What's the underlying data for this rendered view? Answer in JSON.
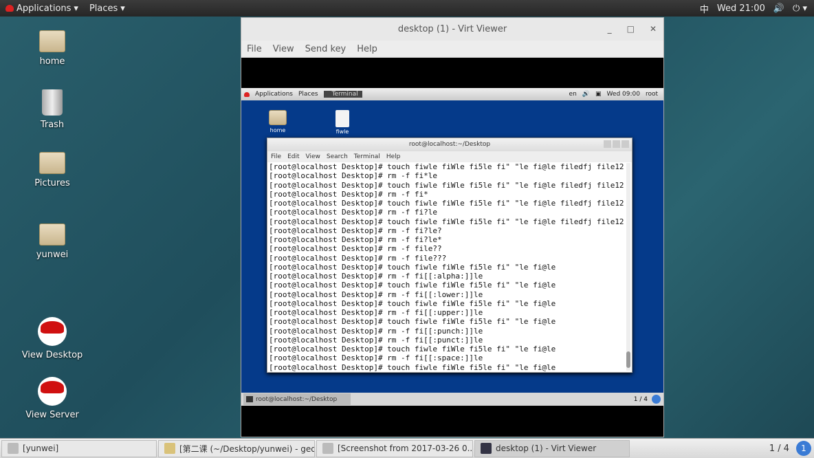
{
  "topbar": {
    "applications": "Applications",
    "places": "Places",
    "input_method": "中",
    "clock": "Wed 21:00"
  },
  "desktop_icons": [
    {
      "label": "home"
    },
    {
      "label": "Trash"
    },
    {
      "label": "Pictures"
    },
    {
      "label": "yunwei"
    },
    {
      "label": "View Desktop"
    },
    {
      "label": "View Server"
    }
  ],
  "viewer": {
    "title": "desktop (1) - Virt Viewer",
    "menu": [
      "File",
      "View",
      "Send key",
      "Help"
    ]
  },
  "guest": {
    "topbar": {
      "applications": "Applications",
      "places": "Places",
      "task": "Terminal",
      "lang": "en",
      "clock": "Wed 09:00",
      "user": "root"
    },
    "icons": [
      {
        "label": "home"
      },
      {
        "label": "fiwle"
      }
    ],
    "terminal": {
      "title": "root@localhost:~/Desktop",
      "menu": [
        "File",
        "Edit",
        "View",
        "Search",
        "Terminal",
        "Help"
      ],
      "lines": [
        "[root@localhost Desktop]# touch fiwle fiWle fi5le fi\" \"le fi@le filedfj file12",
        "[root@localhost Desktop]# rm -f fi*le",
        "[root@localhost Desktop]# touch fiwle fiWle fi5le fi\" \"le fi@le filedfj file12",
        "[root@localhost Desktop]# rm -f fi*",
        "[root@localhost Desktop]# touch fiwle fiWle fi5le fi\" \"le fi@le filedfj file12",
        "[root@localhost Desktop]# rm -f fi?le",
        "[root@localhost Desktop]# touch fiwle fiWle fi5le fi\" \"le fi@le filedfj file12",
        "[root@localhost Desktop]# rm -f fi?le?",
        "[root@localhost Desktop]# rm -f fi?le*",
        "[root@localhost Desktop]# rm -f file??",
        "[root@localhost Desktop]# rm -f file???",
        "[root@localhost Desktop]# touch fiwle fiWle fi5le fi\" \"le fi@le",
        "[root@localhost Desktop]# rm -f fi[[:alpha:]]le",
        "[root@localhost Desktop]# touch fiwle fiWle fi5le fi\" \"le fi@le",
        "[root@localhost Desktop]# rm -f fi[[:lower:]]le",
        "[root@localhost Desktop]# touch fiwle fiWle fi5le fi\" \"le fi@le",
        "[root@localhost Desktop]# rm -f fi[[:upper:]]le",
        "[root@localhost Desktop]# touch fiwle fiWle fi5le fi\" \"le fi@le",
        "[root@localhost Desktop]# rm -f fi[[:punch:]]le",
        "[root@localhost Desktop]# rm -f fi[[:punct:]]le",
        "[root@localhost Desktop]# touch fiwle fiWle fi5le fi\" \"le fi@le",
        "[root@localhost Desktop]# rm -f fi[[:space:]]le",
        "[root@localhost Desktop]# touch fiwle fiWle fi5le fi\" \"le fi@le"
      ]
    },
    "bottombar": {
      "task": "root@localhost:~/Desktop",
      "workspace": "1 / 4"
    }
  },
  "taskbar": {
    "items": [
      "[yunwei]",
      "[第二课 (~/Desktop/yunwei) - ged...",
      "[Screenshot from 2017-03-26 0...",
      "desktop (1) - Virt Viewer"
    ],
    "workspace": "1 / 4"
  }
}
